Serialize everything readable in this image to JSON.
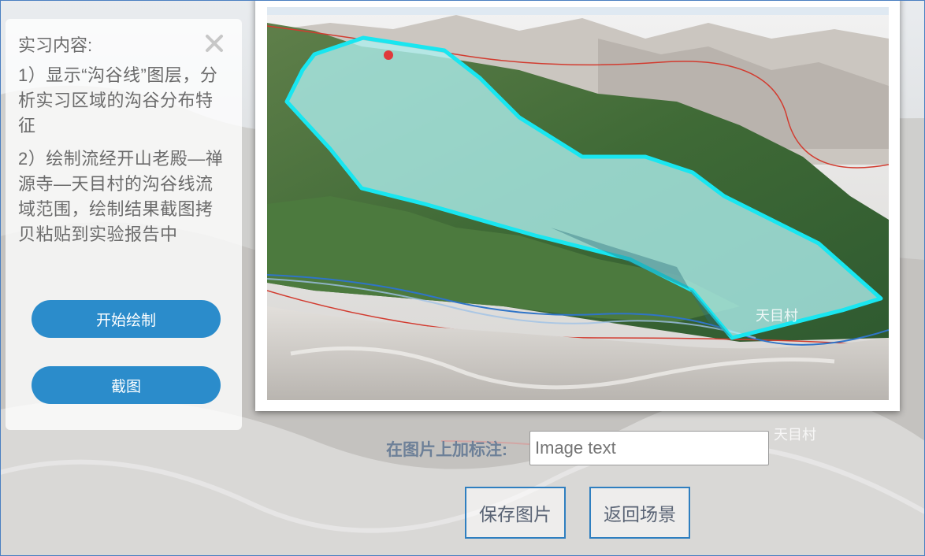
{
  "panel": {
    "title": "实习内容:",
    "close_icon": "close-icon",
    "tasks": [
      "1）显示“沟谷线”图层，分析实习区域的沟谷分布特征",
      "2）绘制流经开山老殿—禅源寺—天目村的沟谷线流域范围，绘制结果截图拷贝粘贴到实验报告中"
    ],
    "start_draw_label": "开始绘制",
    "screenshot_label": "截图"
  },
  "preview": {
    "village_label": "天目村"
  },
  "background": {
    "village_label": "天目村"
  },
  "annotation": {
    "label": "在图片上加标注:",
    "placeholder": "Image text"
  },
  "actions": {
    "save_label": "保存图片",
    "back_label": "返回场景"
  },
  "colors": {
    "button_blue": "#2b8ccb",
    "outline_blue": "#2f7fc0",
    "polygon_fill": "#aef0f0",
    "polygon_stroke": "#19e6f0"
  }
}
